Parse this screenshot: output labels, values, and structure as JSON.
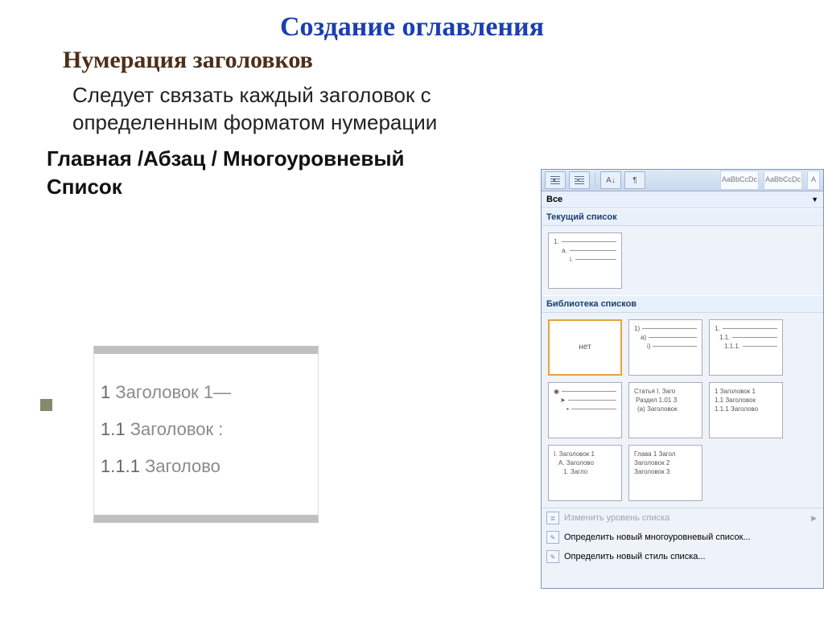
{
  "title": "Создание оглавления",
  "subtitle": "Нумерация заголовков",
  "body": "Следует связать каждый заголовок с определенным форматом нумерации",
  "path": "Главная /Абзац / Многоуровневый Список",
  "preview": {
    "lines": [
      {
        "num": "1",
        "text": "Заголовок 1"
      },
      {
        "num": "1.1",
        "text": "Заголовок :"
      },
      {
        "num": "1.1.1",
        "text": "Заголово"
      }
    ]
  },
  "panel": {
    "all": "Все",
    "section_current": "Текущий список",
    "section_library": "Библиотека списков",
    "toolbar": {
      "styles": [
        "AaBbCcDc",
        "AaBbCcDc",
        "A"
      ]
    },
    "current_thumb": [
      "1.",
      "a.",
      "i."
    ],
    "lib": {
      "none": "нет",
      "t1": [
        "1)",
        "a)",
        "i)"
      ],
      "t2": [
        "1.",
        "1.1.",
        "1.1.1."
      ],
      "t3": [
        "◉",
        "➤",
        "▪"
      ],
      "t4": [
        "Статья I. Заго",
        "Раздел 1.01 З",
        "(a) Заголовок"
      ],
      "t5": [
        "1 Заголовок 1",
        "1.1 Заголовок",
        "1.1.1 Заголово"
      ],
      "t6": [
        "I. Заголовок 1",
        "A. Заголово",
        "1. Загло"
      ],
      "t7": [
        "Глава 1 Загол",
        "Заголовок 2",
        "Заголовок 3"
      ]
    },
    "menu": {
      "change_level": "Изменить уровень списка",
      "define_multi": "Определить новый многоуровневый список...",
      "define_style": "Определить новый стиль списка..."
    }
  }
}
